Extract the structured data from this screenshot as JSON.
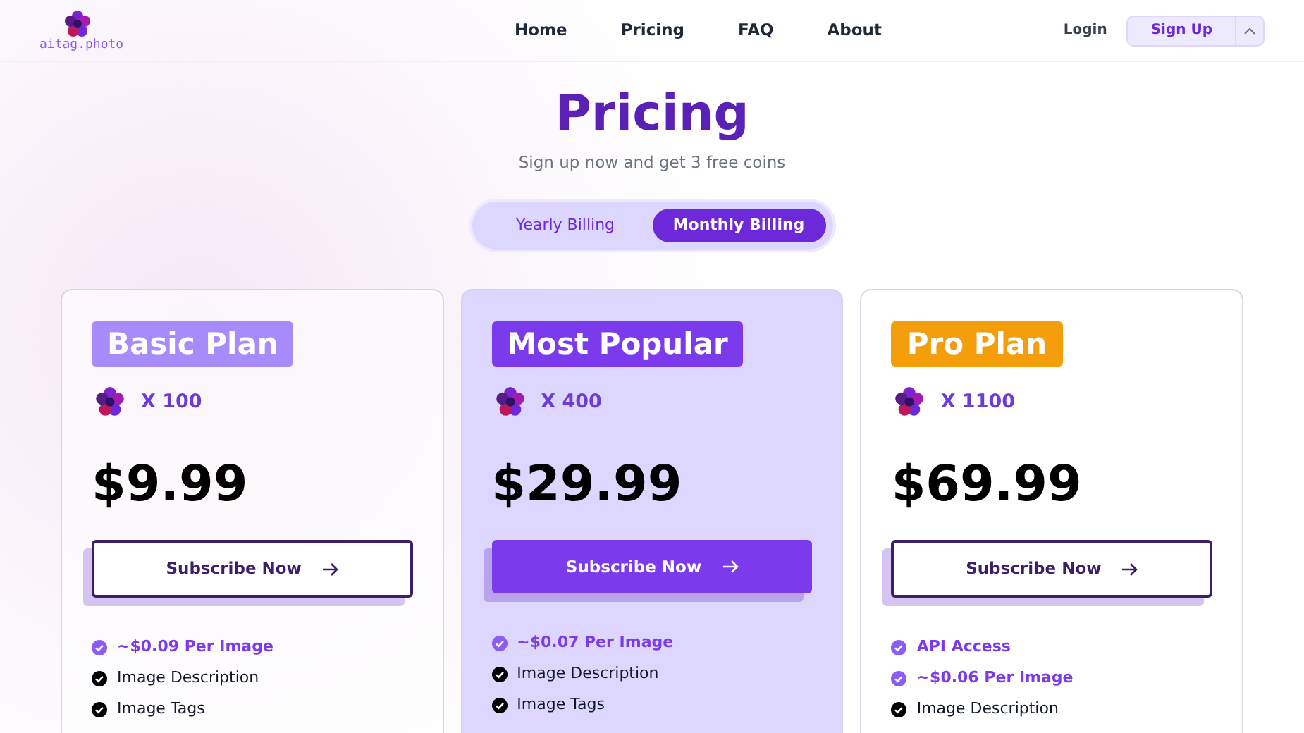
{
  "logo": {
    "text": "aitag.photo"
  },
  "nav": [
    {
      "label": "Home"
    },
    {
      "label": "Pricing"
    },
    {
      "label": "FAQ"
    },
    {
      "label": "About"
    }
  ],
  "auth": {
    "login": "Login",
    "signup": "Sign Up"
  },
  "heading": {
    "title": "Pricing",
    "subtitle": "Sign up now and get 3 free coins"
  },
  "billing_tabs": [
    {
      "label": "Yearly Billing",
      "selected": false
    },
    {
      "label": "Monthly Billing",
      "selected": true
    }
  ],
  "plans": [
    {
      "name": "Basic Plan",
      "color": "#a78bfa",
      "featured": false,
      "coins": "X 100",
      "price": "$9.99",
      "button": "Subscribe Now",
      "features": [
        {
          "text": "~$0.09 Per Image",
          "kind": "highlight"
        },
        {
          "text": "Image Description",
          "kind": "normal"
        },
        {
          "text": "Image Tags",
          "kind": "normal"
        }
      ]
    },
    {
      "name": "Most Popular",
      "color": "#7c3aed",
      "featured": true,
      "coins": "X 400",
      "price": "$29.99",
      "button": "Subscribe Now",
      "features": [
        {
          "text": "~$0.07 Per Image",
          "kind": "highlight"
        },
        {
          "text": "Image Description",
          "kind": "normal"
        },
        {
          "text": "Image Tags",
          "kind": "normal"
        }
      ]
    },
    {
      "name": "Pro Plan",
      "color": "#f59e0b",
      "featured": false,
      "coins": "X 1100",
      "price": "$69.99",
      "button": "Subscribe Now",
      "features": [
        {
          "text": "API Access",
          "kind": "highlight"
        },
        {
          "text": "~$0.06 Per Image",
          "kind": "highlight"
        },
        {
          "text": "Image Description",
          "kind": "normal"
        }
      ]
    }
  ]
}
